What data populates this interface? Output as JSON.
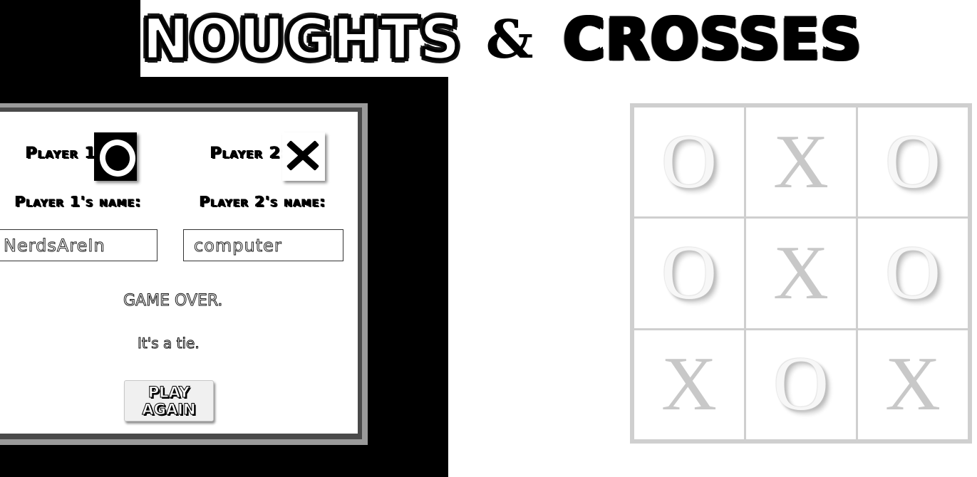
{
  "title": {
    "word1": "Noughts",
    "amp": "&",
    "word2": "Crosses"
  },
  "settings": {
    "player1_label": "Player 1:",
    "player2_label": "Player 2:",
    "player1_marker": "O",
    "player2_marker": "X",
    "player1_name_label": "Player 1's name:",
    "player2_name_label": "Player 2's name:",
    "player1_name": "NerdsAreIn",
    "player2_name": "computer"
  },
  "status": {
    "title": "GAME OVER.",
    "message": "It's a tie.",
    "play_again": "PLAY AGAIN"
  },
  "board": {
    "cells": [
      "O",
      "X",
      "O",
      "O",
      "X",
      "O",
      "X",
      "O",
      "X"
    ]
  },
  "colors": {
    "background": "#ffffff",
    "left_panel_background": "#000000",
    "grid_line": "#cfcfcf",
    "mark": "#c6c6c6"
  }
}
